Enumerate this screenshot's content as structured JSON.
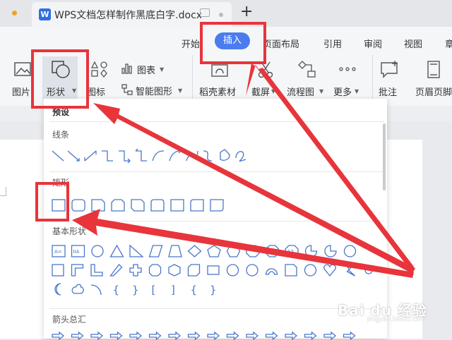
{
  "tab_bar": {
    "document_title": "WPS文档怎样制作黑底白字.docx",
    "logo_letter": "W",
    "add_tab": "+"
  },
  "menu": {
    "items": [
      "开始",
      "插入",
      "页面布局",
      "引用",
      "审阅",
      "视图",
      "章"
    ],
    "active": "插入"
  },
  "toolbar": {
    "picture": "图片",
    "shape": "形状",
    "icon": "图标",
    "chart": "图表",
    "smart_shape": "智能图形",
    "daoke_material": "稻壳素材",
    "screenshot": "截屏",
    "flowchart": "流程图",
    "more": "更多",
    "comment": "批注",
    "header_footer": "页眉页脚"
  },
  "shape_panel": {
    "preset_label": "预设",
    "sections": {
      "lines": "线条",
      "rectangles": "矩形",
      "basic_shapes": "基本形状",
      "arrows": "箭头总汇"
    },
    "basic_shape_labels": [
      "A=",
      "IIA",
      "12"
    ],
    "bracket_glyphs": [
      "{",
      "}",
      "[",
      "]",
      "{",
      "}"
    ]
  },
  "watermark": {
    "text": "Bai du 经验",
    "sub": "jingyan.baidu.com"
  },
  "colors": {
    "accent": "#4a7cf0",
    "highlight": "#e8343b",
    "icon_stroke": "#4a76c9",
    "logo_bg": "#2f6fe3"
  }
}
